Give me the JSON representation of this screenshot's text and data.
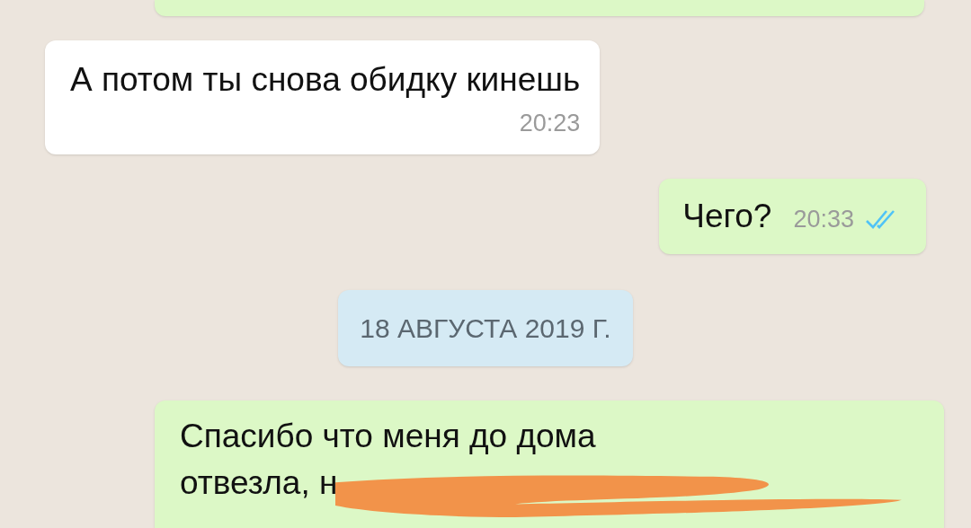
{
  "messages": [
    {
      "kind": "message",
      "outgoing": true
    },
    {
      "kind": "message",
      "outgoing": false,
      "text": "А потом ты снова обидку кинешь",
      "time": "20:23"
    },
    {
      "kind": "message",
      "outgoing": true,
      "text": "Чего?",
      "time": "20:33",
      "read": true
    },
    {
      "kind": "date",
      "text": "18 АВГУСТА 2019 Г."
    },
    {
      "kind": "message",
      "outgoing": true,
      "lines": [
        "Спасибо что меня до дома",
        "отвезла, н"
      ],
      "redacted": true
    }
  ]
}
